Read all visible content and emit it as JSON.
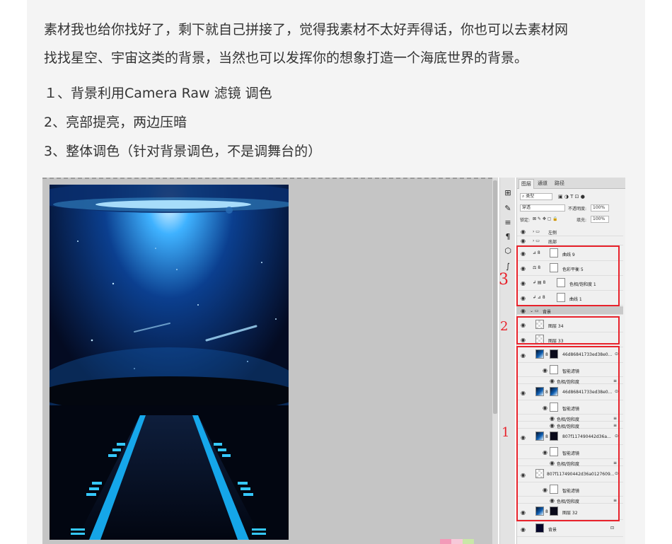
{
  "article": {
    "paragraph": "素材我也给你找好了，剩下就自己拼接了，觉得我素材不太好弄得话，你也可以去素材网找找星空、宇宙这类的背景，当然也可以发挥你的想象打造一个海底世界的背景。",
    "paragraph_line1": "素材我也给你找好了，剩下就自己拼接了，觉得我素材不太好弄得话，你也可以去素材网",
    "paragraph_line2": "找找星空、宇宙这类的背景，当然也可以发挥你的想象打造一个海底世界的背景。",
    "steps": [
      "１、背景利用Camera Raw 滤镜 调色",
      "2、亮部提亮，两边压暗",
      "3、整体调色（针对背景调色，不是调舞台的）"
    ]
  },
  "layers_panel": {
    "tabs": [
      "图层",
      "通道",
      "路径"
    ],
    "active_tab": "图层",
    "filter_label": "类型",
    "blend_mode": "穿透",
    "opacity_label": "不透明度:",
    "opacity_value": "100%",
    "lock_label": "锁定:",
    "fill_label": "填充:",
    "fill_value": "100%",
    "layers": [
      {
        "name": "左侧",
        "kind": "group"
      },
      {
        "name": "底部",
        "kind": "group"
      },
      {
        "name": "曲线 9",
        "kind": "adjustment"
      },
      {
        "name": "色彩平衡 5",
        "kind": "adjustment"
      },
      {
        "name": "色相/饱和度 1",
        "kind": "adjustment"
      },
      {
        "name": "曲线 1",
        "kind": "adjustment"
      },
      {
        "name": "背景",
        "kind": "group"
      },
      {
        "name": "图层 34",
        "kind": "pixel"
      },
      {
        "name": "图层 33",
        "kind": "pixel"
      },
      {
        "name": "46d86841733ed38e0...",
        "kind": "smart"
      },
      {
        "name": "智能滤镜",
        "kind": "filter-mask"
      },
      {
        "name": "色相/饱和度",
        "kind": "filter"
      },
      {
        "name": "46d86841733ed38e0...",
        "kind": "smart"
      },
      {
        "name": "智能滤镜",
        "kind": "filter-mask"
      },
      {
        "name": "色相/饱和度",
        "kind": "filter"
      },
      {
        "name": "色相/饱和度",
        "kind": "filter"
      },
      {
        "name": "807f117490442d36a...",
        "kind": "smart"
      },
      {
        "name": "智能滤镜",
        "kind": "filter-mask"
      },
      {
        "name": "色相/饱和度",
        "kind": "filter"
      },
      {
        "name": "807f117490442d36a0127609...",
        "kind": "smart"
      },
      {
        "name": "智能滤镜",
        "kind": "filter-mask"
      },
      {
        "name": "色相/饱和度",
        "kind": "filter"
      },
      {
        "name": "图层 32",
        "kind": "pixel"
      },
      {
        "name": "背景",
        "kind": "background"
      }
    ]
  },
  "annotations": {
    "box1": "1",
    "box2": "2",
    "box3": "3",
    "color": "#e8222b"
  },
  "icons": [
    "eye-icon",
    "folder-icon",
    "link-icon",
    "fx-icon",
    "lock-icon",
    "search-icon"
  ]
}
